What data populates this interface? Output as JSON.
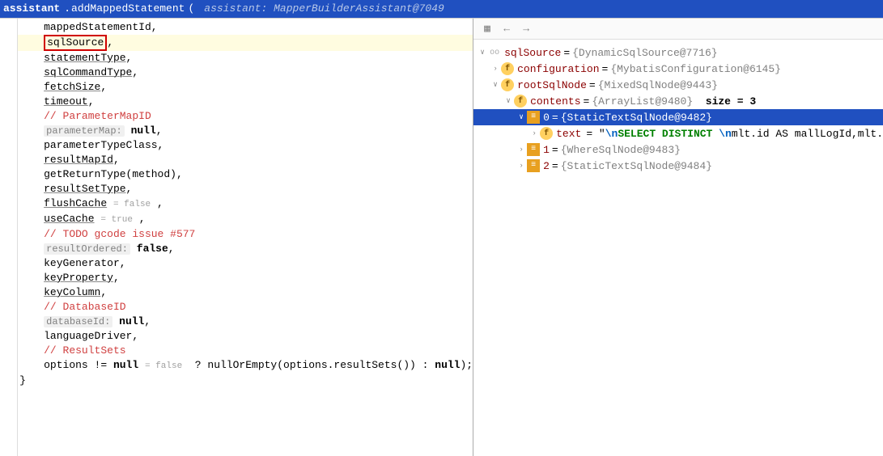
{
  "topbar": {
    "object": "assistant",
    "method": "addMappedStatement",
    "hint_label": "assistant:",
    "hint_value": "MapperBuilderAssistant@7049"
  },
  "code": {
    "mappedStatementId": "mappedStatementId,",
    "sqlSource": "sqlSource",
    "sqlSource_comma": ",",
    "statementType": "statementType",
    "sqlCommandType": "sqlCommandType",
    "fetchSize": "fetchSize",
    "timeout": "timeout",
    "c_parameterMap": "// ParameterMapID",
    "parameterMap_chip": "parameterMap:",
    "parameterMap_val": "null",
    "parameterTypeClass": "parameterTypeClass,",
    "resultMapId": "resultMapId",
    "getReturnType": "getReturnType(method),",
    "resultSetType": "resultSetType",
    "flushCache": "flushCache",
    "flushCache_inlay": "= false",
    "useCache": "useCache",
    "useCache_inlay": "= true",
    "c_todo": "// TODO gcode issue #577",
    "resultOrdered_chip": "resultOrdered:",
    "resultOrdered_val": "false",
    "keyGenerator": "keyGenerator,",
    "keyProperty": "keyProperty",
    "keyColumn": "keyColumn",
    "c_database": "// DatabaseID",
    "databaseId_chip": "databaseId:",
    "databaseId_val": "null",
    "languageDriver": "languageDriver,",
    "c_resultsets": "// ResultSets",
    "options_line_pre": "options != ",
    "options_null": "null",
    "options_inlay": "= false",
    "options_line_post": "  ? nullOrEmpty(options.resultSets()) : ",
    "options_null2": "null",
    "options_end": ");",
    "brace": "}"
  },
  "debug": {
    "root": {
      "name": "sqlSource",
      "val": "{DynamicSqlSource@7716}"
    },
    "configuration": {
      "name": "configuration",
      "val": "{MybatisConfiguration@6145}"
    },
    "rootSqlNode": {
      "name": "rootSqlNode",
      "val": "{MixedSqlNode@9443}"
    },
    "contents": {
      "name": "contents",
      "val": "{ArrayList@9480}",
      "size_label": "size = 3"
    },
    "item0": {
      "name": "0",
      "val": "{StaticTextSqlNode@9482}"
    },
    "text": {
      "name": "text",
      "prefix": "= \"",
      "esc1": "\\n",
      "sql": "SELECT DISTINCT ",
      "esc2": "\\n",
      "rest": "mlt.id AS mallLogId,mlt."
    },
    "item1": {
      "name": "1",
      "val": "{WhereSqlNode@9483}"
    },
    "item2": {
      "name": "2",
      "val": "{StaticTextSqlNode@9484}"
    }
  }
}
